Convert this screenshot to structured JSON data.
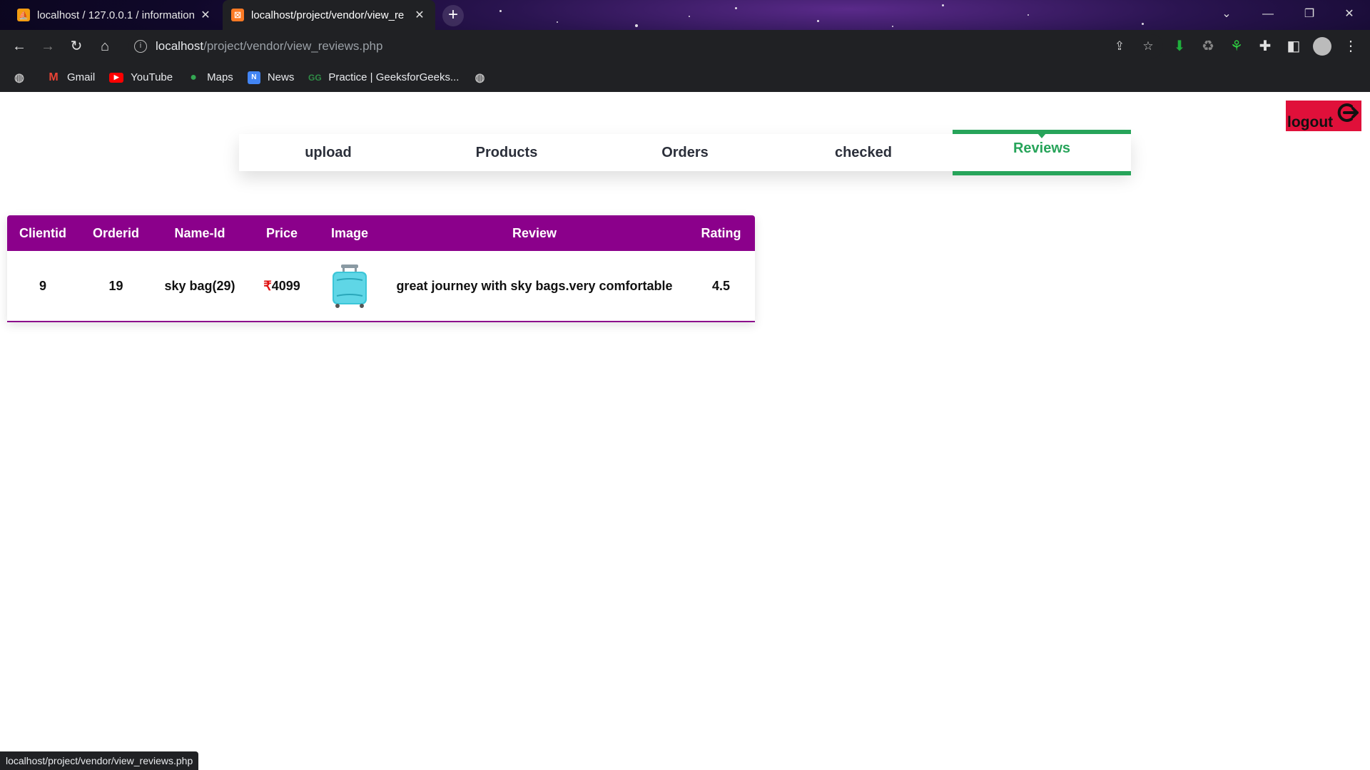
{
  "browser": {
    "tabs": [
      {
        "title": "localhost / 127.0.0.1 / information",
        "active": false
      },
      {
        "title": "localhost/project/vendor/view_re",
        "active": true
      }
    ],
    "url_host": "localhost",
    "url_path": "/project/vendor/view_reviews.php",
    "bookmarks": [
      "Gmail",
      "YouTube",
      "Maps",
      "News",
      "Practice | GeeksforGeeks..."
    ],
    "status_url": "localhost/project/vendor/view_reviews.php"
  },
  "page": {
    "logout_label": "logout",
    "nav": [
      "upload",
      "Products",
      "Orders",
      "checked",
      "Reviews"
    ],
    "active_nav": "Reviews",
    "table": {
      "headers": [
        "Clientid",
        "Orderid",
        "Name-Id",
        "Price",
        "Image",
        "Review",
        "Rating"
      ],
      "rows": [
        {
          "clientid": "9",
          "orderid": "19",
          "name_id": "sky bag(29)",
          "price_symbol": "₹",
          "price": "4099",
          "image": "blue-suitcase-icon",
          "review": "great journey with sky bags.very comfortable",
          "rating": "4.5"
        }
      ]
    }
  },
  "colors": {
    "table_header": "#8b008b",
    "active_tab": "#27a45a",
    "logout_bg": "#e0103a"
  }
}
